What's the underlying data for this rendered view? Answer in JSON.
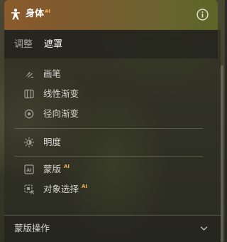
{
  "header": {
    "title": "身体",
    "ai_badge": "AI",
    "icon": "person-icon",
    "info_icon": "info-icon"
  },
  "tabs": [
    {
      "label": "调整",
      "active": false
    },
    {
      "label": "遮罩",
      "active": true
    }
  ],
  "menu": {
    "brush": {
      "label": "画笔",
      "icon": "brush-icon"
    },
    "linear": {
      "label": "线性渐变",
      "icon": "linear-gradient-icon"
    },
    "radial": {
      "label": "径向渐变",
      "icon": "radial-gradient-icon"
    },
    "luminance": {
      "label": "明度",
      "icon": "brightness-icon"
    },
    "mask": {
      "label": "蒙版",
      "ai": "AI",
      "icon": "ai-mask-icon"
    },
    "select_object": {
      "label": "对象选择",
      "ai": "AI",
      "icon": "select-object-icon"
    }
  },
  "footer": {
    "label": "蒙版操作",
    "icon": "chevron-down-icon"
  },
  "colors": {
    "header_start": "#8a5a2c",
    "header_end": "#5b6628",
    "ai_accent": "#f0b15c",
    "text_active": "#ffffff",
    "text_muted": "#a9a9a2"
  }
}
